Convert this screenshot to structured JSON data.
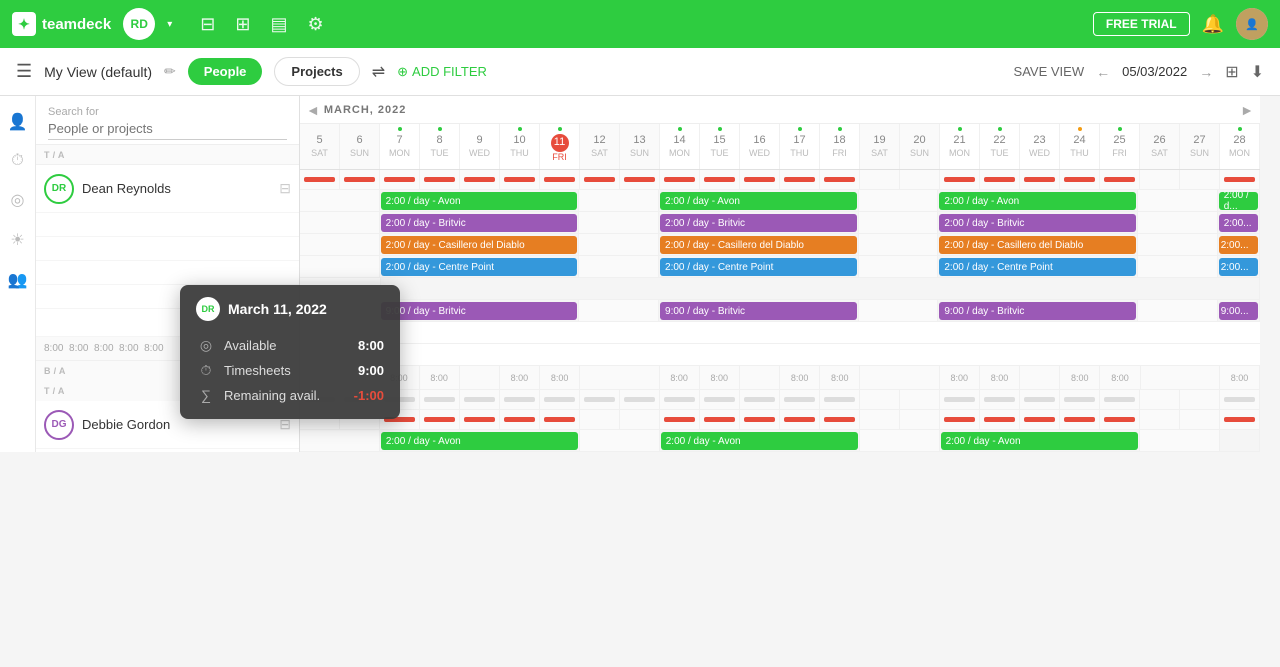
{
  "app": {
    "name": "teamdeck",
    "logo_text": "td"
  },
  "topnav": {
    "user_initials": "RD",
    "free_trial_label": "FREE TRIAL"
  },
  "subnav": {
    "view_name": "My View (default)",
    "people_btn": "People",
    "projects_btn": "Projects",
    "add_filter": "ADD FILTER",
    "save_view": "SAVE VIEW",
    "date_range": "05/03/2022"
  },
  "search": {
    "label": "Search for",
    "placeholder": "People or projects"
  },
  "month_label": "MARCH, 2022",
  "days": [
    {
      "num": "5",
      "name": "SAT",
      "dot": "none",
      "weekend": true
    },
    {
      "num": "6",
      "name": "SUN",
      "dot": "none",
      "weekend": true
    },
    {
      "num": "7",
      "name": "MON",
      "dot": "green",
      "weekend": false
    },
    {
      "num": "8",
      "name": "TUE",
      "dot": "green",
      "weekend": false
    },
    {
      "num": "9",
      "name": "WED",
      "dot": "none",
      "weekend": false
    },
    {
      "num": "10",
      "name": "THU",
      "dot": "green",
      "weekend": false
    },
    {
      "num": "11",
      "name": "FRI",
      "dot": "green",
      "weekend": false,
      "today": true
    },
    {
      "num": "12",
      "name": "SAT",
      "dot": "none",
      "weekend": true
    },
    {
      "num": "13",
      "name": "SUN",
      "dot": "none",
      "weekend": true
    },
    {
      "num": "14",
      "name": "MON",
      "dot": "green",
      "weekend": false
    },
    {
      "num": "15",
      "name": "TUE",
      "dot": "green",
      "weekend": false
    },
    {
      "num": "16",
      "name": "WED",
      "dot": "none",
      "weekend": false
    },
    {
      "num": "17",
      "name": "THU",
      "dot": "green",
      "weekend": false
    },
    {
      "num": "18",
      "name": "FRI",
      "dot": "green",
      "weekend": false
    },
    {
      "num": "19",
      "name": "SAT",
      "dot": "none",
      "weekend": true
    },
    {
      "num": "20",
      "name": "SUN",
      "dot": "none",
      "weekend": true
    },
    {
      "num": "21",
      "name": "MON",
      "dot": "green",
      "weekend": false
    },
    {
      "num": "22",
      "name": "TUE",
      "dot": "green",
      "weekend": false
    },
    {
      "num": "23",
      "name": "WED",
      "dot": "none",
      "weekend": false
    },
    {
      "num": "24",
      "name": "THU",
      "dot": "orange",
      "weekend": false
    },
    {
      "num": "25",
      "name": "FRI",
      "dot": "green",
      "weekend": false
    },
    {
      "num": "26",
      "name": "SAT",
      "dot": "none",
      "weekend": true
    },
    {
      "num": "27",
      "name": "SUN",
      "dot": "none",
      "weekend": true
    },
    {
      "num": "28",
      "name": "MON",
      "dot": "green",
      "weekend": false
    }
  ],
  "person1": {
    "name": "Dean Reynolds",
    "initials": "DR",
    "avatar_color": "#2ecc40",
    "events_row1": [
      {
        "label": "2:00 / day - Avon",
        "color": "#2ecc40",
        "start": 2,
        "span": 6
      },
      {
        "label": "2:00 / day - Britvic",
        "color": "#9b59b6",
        "start": 2,
        "span": 6
      },
      {
        "label": "2:00 / day - Casillero del Diablo",
        "color": "#e67e22",
        "start": 2,
        "span": 6
      },
      {
        "label": "2:00 / day - Centre Point",
        "color": "#3498db",
        "start": 2,
        "span": 6
      }
    ],
    "timesheet_label": "9:00 / day - Britvic"
  },
  "person2": {
    "name": "Debbie Gordon",
    "initials": "DG",
    "avatar_color": "#9b59b6",
    "events": [
      {
        "label": "2:00 / day - Avon",
        "color": "#2ecc40"
      }
    ]
  },
  "tooltip": {
    "date": "March 11, 2022",
    "avatar_initials": "DR",
    "available_label": "Available",
    "available_value": "8:00",
    "timesheets_label": "Timesheets",
    "timesheets_value": "9:00",
    "remaining_label": "Remaining avail.",
    "remaining_value": "-1:00"
  },
  "metric_labels": {
    "ba": "B / A",
    "ta": "T / A"
  }
}
